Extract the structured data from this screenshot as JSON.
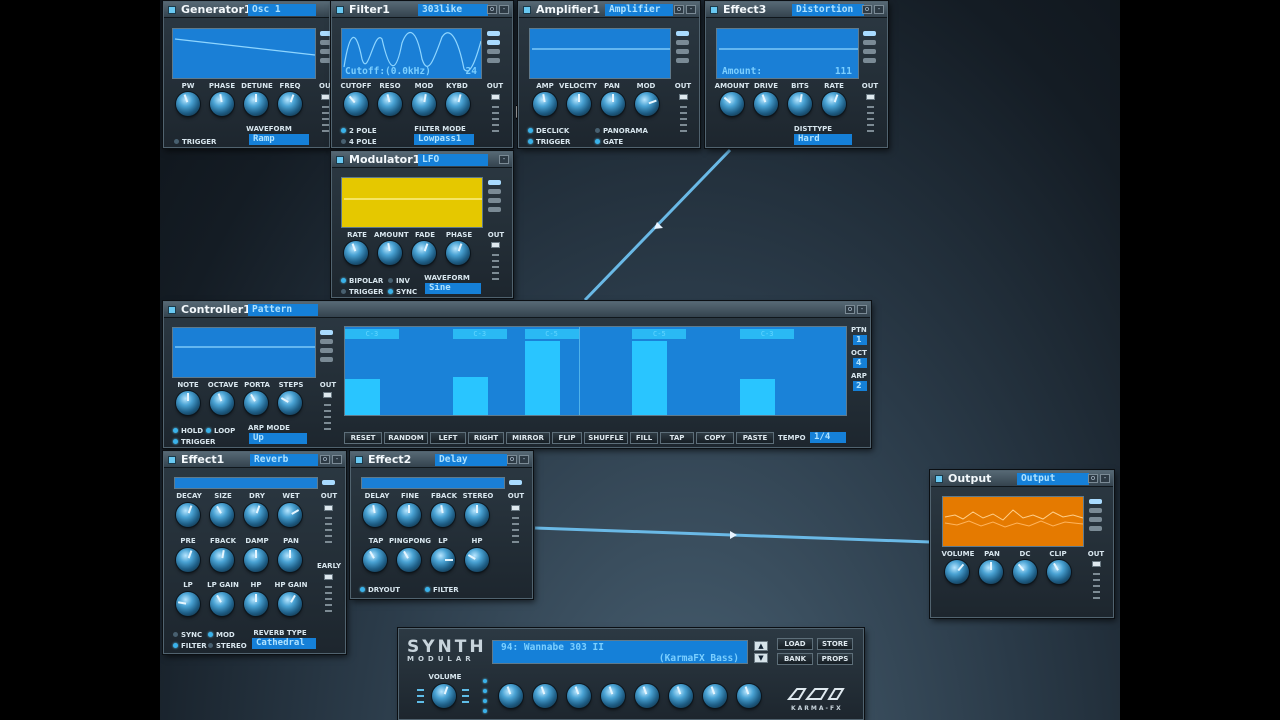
{
  "modules": {
    "generator": {
      "title": "Generator1",
      "preset": "Osc 1",
      "knob_labels": [
        "PW",
        "PHASE",
        "DETUNE",
        "FREQ"
      ],
      "out_label": "OUT",
      "trigger": "TRIGGER",
      "waveform_label": "WAVEFORM",
      "waveform_value": "Ramp"
    },
    "filter": {
      "title": "Filter1",
      "preset": "303like",
      "scope_text": "Cutoff:(0.0kHz)",
      "scope_value": "24",
      "knob_labels": [
        "CUTOFF",
        "RESO",
        "MOD",
        "KYBD"
      ],
      "out_label": "OUT",
      "pole2": "2 POLE",
      "pole4": "4 POLE",
      "mode_label": "FILTER MODE",
      "mode_value": "Lowpass1"
    },
    "amplifier": {
      "title": "Amplifier1",
      "preset": "Amplifier",
      "knob_labels": [
        "AMP",
        "VELOCITY",
        "PAN",
        "MOD"
      ],
      "out_label": "OUT",
      "declick": "DECLICK",
      "panorama": "PANORAMA",
      "trigger": "TRIGGER",
      "gate": "GATE"
    },
    "effect3": {
      "title": "Effect3",
      "preset": "Distortion",
      "scope_text": "Amount:",
      "scope_value": "111",
      "knob_labels": [
        "AMOUNT",
        "DRIVE",
        "BITS",
        "RATE"
      ],
      "out_label": "OUT",
      "type_label": "DISTTYPE",
      "type_value": "Hard"
    },
    "modulator": {
      "title": "Modulator1",
      "preset": "LFO",
      "knob_labels": [
        "RATE",
        "AMOUNT",
        "FADE",
        "PHASE"
      ],
      "out_label": "OUT",
      "bipolar": "BIPOLAR",
      "inv": "INV",
      "trigger": "TRIGGER",
      "sync": "SYNC",
      "waveform_label": "WAVEFORM",
      "waveform_value": "Sine"
    },
    "controller": {
      "title": "Controller1",
      "preset": "Pattern",
      "knob_labels": [
        "NOTE",
        "OCTAVE",
        "PORTA",
        "STEPS"
      ],
      "out_label": "OUT",
      "hold": "HOLD",
      "loop": "LOOP",
      "trigger": "TRIGGER",
      "arp_label": "ARP MODE",
      "arp_value": "Up",
      "ptn_label": "PTN",
      "ptn_value": "1",
      "oct_label": "OCT",
      "oct_value": "4",
      "arp_side_label": "ARP",
      "arp_side_value": "2",
      "buttons": [
        "RESET",
        "RANDOM",
        "LEFT",
        "RIGHT",
        "MIRROR",
        "FLIP",
        "SHUFFLE",
        "FILL",
        "TAP",
        "COPY",
        "PASTE"
      ],
      "tempo_label": "TEMPO",
      "tempo_value": "1/4",
      "note_labels": [
        "C-3",
        "C-3",
        "C-5",
        "C-5",
        "C-3"
      ],
      "step_levels": [
        0.4,
        0,
        0,
        0.42,
        0,
        0.82,
        0,
        0,
        0.82,
        0,
        0,
        0.4,
        0,
        0
      ]
    },
    "effect1": {
      "title": "Effect1",
      "preset": "Reverb",
      "row1": [
        "DECAY",
        "SIZE",
        "DRY",
        "WET"
      ],
      "row2": [
        "PRE",
        "FBACK",
        "DAMP",
        "PAN"
      ],
      "row3": [
        "LP",
        "LP GAIN",
        "HP",
        "HP GAIN"
      ],
      "out_label": "OUT",
      "early_label": "EARLY",
      "sync": "SYNC",
      "mod": "MOD",
      "filter": "FILTER",
      "stereo": "STEREO",
      "type_label": "REVERB TYPE",
      "type_value": "Cathedral"
    },
    "effect2": {
      "title": "Effect2",
      "preset": "Delay",
      "row1": [
        "DELAY",
        "FINE",
        "FBACK",
        "STEREO"
      ],
      "row2": [
        "TAP",
        "PINGPONG",
        "LP",
        "HP"
      ],
      "out_label": "OUT",
      "dryout": "DRYOUT",
      "filter": "FILTER"
    },
    "output": {
      "title": "Output",
      "preset": "Output",
      "knob_labels": [
        "VOLUME",
        "PAN",
        "DC",
        "CLIP"
      ],
      "out_label": "OUT"
    }
  },
  "master": {
    "logo_main": "SYNTH",
    "logo_sub": "MODULAR",
    "preset_line1": "94: Wannabe 303 II",
    "preset_line2": "(KarmaFX Bass)",
    "load": "LOAD",
    "store": "STORE",
    "bank": "BANK",
    "props": "PROPS",
    "volume_label": "VOLUME",
    "brand": "KARMA-FX"
  },
  "colors": {
    "accent": "#1580d8",
    "scope_blue": "#1a7fd6",
    "lfo_yellow": "#e5c800",
    "output_orange": "#e57a00"
  }
}
